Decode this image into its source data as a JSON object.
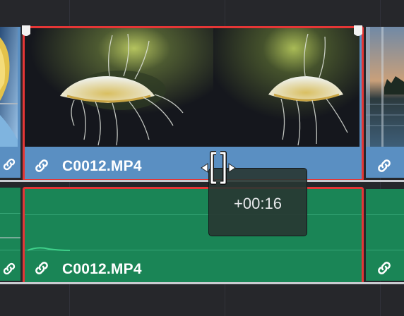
{
  "timeline": {
    "video_track": {
      "clips": [
        {
          "name": "",
          "tail_visible": true
        },
        {
          "name": "C0012.MP4",
          "selected": true
        },
        {
          "name": "",
          "head_visible": true
        }
      ]
    },
    "audio_track": {
      "clips": [
        {
          "name": ""
        },
        {
          "name": "C0012.MP4",
          "selected": true
        },
        {
          "name": ""
        }
      ]
    },
    "trim_tooltip": {
      "offset": "+00:16"
    },
    "colors": {
      "video_clip": "#5a8fc2",
      "audio_clip": "#1a8556",
      "selection": "#e53636",
      "background": "#26272b"
    },
    "icons": [
      "link-icon",
      "trim-handle-icon",
      "arrow-left-icon",
      "arrow-right-icon",
      "keyframe-marker-icon"
    ]
  }
}
